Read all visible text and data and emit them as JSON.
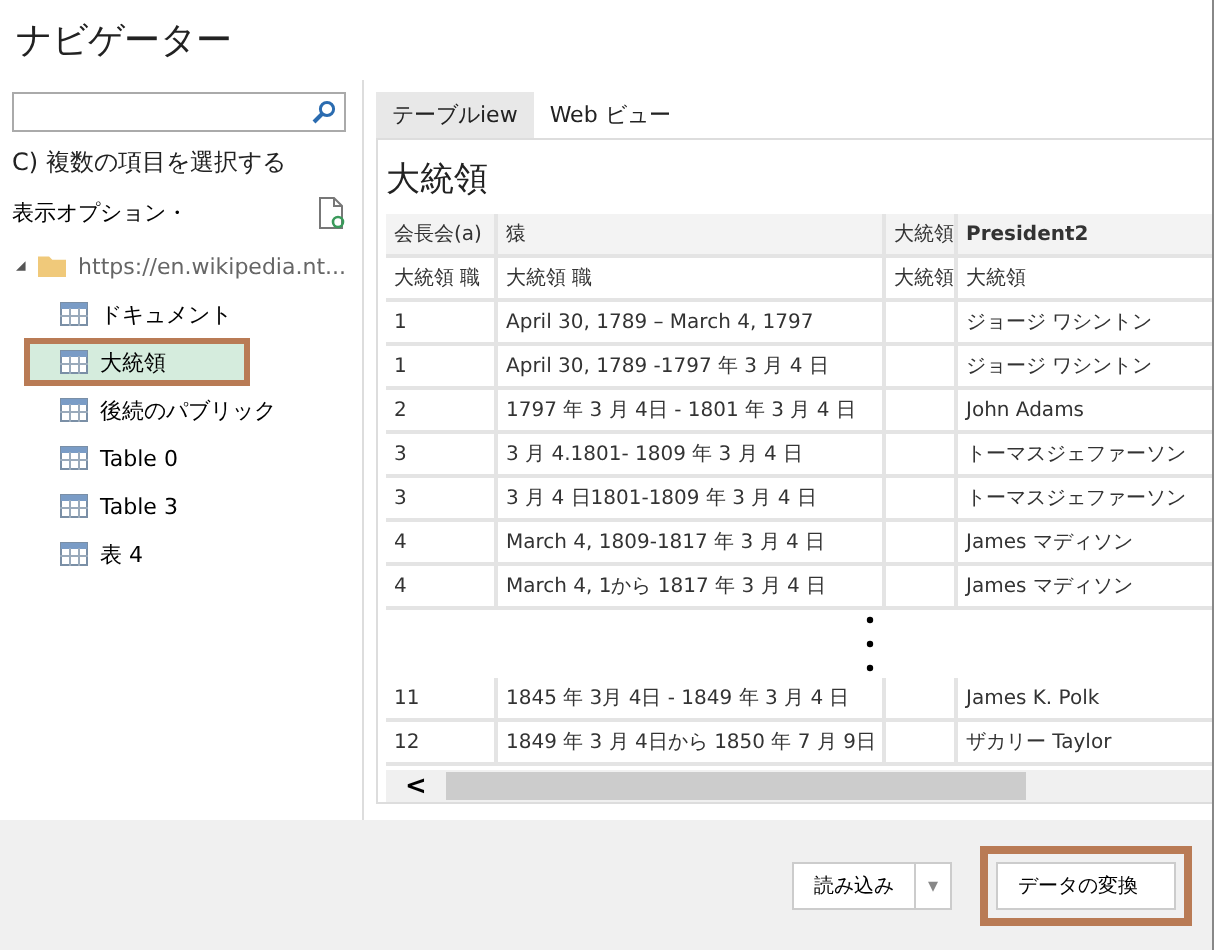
{
  "window": {
    "title": "ナビゲーター"
  },
  "sidebar": {
    "multi_select_label": "C) 複数の項目を選択する",
    "display_options": "表示オプション・",
    "tree": [
      {
        "label": "https://en.wikipedia.nt...",
        "kind": "folder",
        "expanded": true,
        "selected": false,
        "highlighted": false,
        "children": [
          {
            "label": "ドキュメント",
            "kind": "table",
            "selected": false,
            "highlighted": false
          },
          {
            "label": "大統領",
            "kind": "table",
            "selected": true,
            "highlighted": true
          },
          {
            "label": "後続のパブリック",
            "kind": "table",
            "selected": false,
            "highlighted": false
          },
          {
            "label": "Table 0",
            "kind": "table",
            "selected": false,
            "highlighted": false
          },
          {
            "label": "Table 3",
            "kind": "table",
            "selected": false,
            "highlighted": false
          },
          {
            "label": "表 4",
            "kind": "table",
            "selected": false,
            "highlighted": false
          }
        ]
      }
    ]
  },
  "preview": {
    "tabs": [
      {
        "label": "テーブルiew",
        "selected": true
      },
      {
        "label": "Web ビュー",
        "selected": false
      }
    ],
    "heading": "大統領",
    "table": {
      "header_rows": [
        [
          "会長会(a)",
          "猿",
          "大統領",
          "President2"
        ],
        [
          "大統領 職",
          "大統領 職",
          "大統領",
          "大統領"
        ]
      ],
      "rows": [
        {
          "column_1": "1",
          "column_2": "April 30, 1789 – March 4, 1797",
          "column_4": "ジョージ ワシントン"
        },
        {
          "column_1": "1",
          "column_2": "April 30, 1789 -1797 年 3 月 4 日",
          "column_4": "ジョージ ワシントン"
        },
        {
          "column_1": "2",
          "column_2": "1797 年 3 月 4日 - 1801 年 3 月 4 日",
          "column_4": "John Adams"
        },
        {
          "column_1": "3",
          "column_2": "3 月 4.1801- 1809 年 3 月 4 日",
          "column_4": "トーマスジェファーソン"
        },
        {
          "column_1": "3",
          "column_2": "3 月 4 日1801-1809 年 3 月 4 日",
          "column_4": "トーマスジェファーソン"
        },
        {
          "column_1": "4",
          "column_2": "March 4, 1809-1817 年 3 月 4 日",
          "column_4": "James マディソン"
        },
        {
          "column_1": "4",
          "column_2": "March 4, 1から 1817 年 3 月 4 日",
          "column_4": "James マディソン"
        }
      ],
      "rows_after_gap": [
        {
          "column_1": "11",
          "column_2": "1845 年 3月 4日 - 1849 年 3 月 4 日",
          "column_4": "James K. Polk"
        },
        {
          "column_1": "12",
          "column_2": "1849 年 3 月 4日から 1850 年 7 月 9日",
          "column_4": "ザカリー Taylor"
        }
      ],
      "scroll_left": "<"
    }
  },
  "footer": {
    "buttons": [
      {
        "label": "読み込み",
        "kind": "split",
        "highlighted": false,
        "arrow": "▾"
      },
      {
        "label": "データの変換",
        "kind": "plain",
        "highlighted": true
      }
    ]
  }
}
